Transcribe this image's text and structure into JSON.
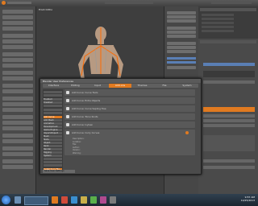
{
  "viewport": {
    "label": "Front Ortho"
  },
  "dialog": {
    "title": "Blender User Preferences",
    "tabs": [
      "Interface",
      "Editing",
      "Input",
      "Add-ons",
      "Themes",
      "File",
      "System"
    ],
    "active_tab": "Add-ons",
    "categories": [
      "",
      "",
      "Enabled",
      "Disabled",
      "",
      "",
      "",
      "Add Curve",
      "Add Mesh",
      "Animation",
      "Development",
      "Game Engine",
      "Import-Export",
      "Mesh",
      "Node",
      "Object",
      "Paint",
      "Render",
      "Rigging",
      "System",
      "",
      "",
      "",
      "Install from File..."
    ],
    "active_categories": [
      "Add Curve",
      "Install from File..."
    ],
    "addons": [
      {
        "label": "Add Curve: Curve Tools"
      },
      {
        "label": "Add Curve: Extra Objects"
      },
      {
        "label": "Add Curve: Curve Sapling Tree"
      },
      {
        "label": "Add Curve: Torus Knots"
      },
      {
        "label": "Add Curve: IvyGen"
      },
      {
        "label": "Add Curve: Curly Curves"
      }
    ],
    "detail": {
      "description_label": "Description:",
      "location_label": "Location:",
      "version_label": "Version:",
      "file_label": "File:",
      "author_label": "Author:",
      "warning_label": "Warning:"
    },
    "save_button": "Save User Settings"
  },
  "taskbar": {
    "time": "9:57 AM",
    "date": "10/25/2013"
  },
  "colors": {
    "accent": "#e07a20",
    "selection_blue": "#5a7fb5",
    "panel": "#4a4a4a"
  }
}
